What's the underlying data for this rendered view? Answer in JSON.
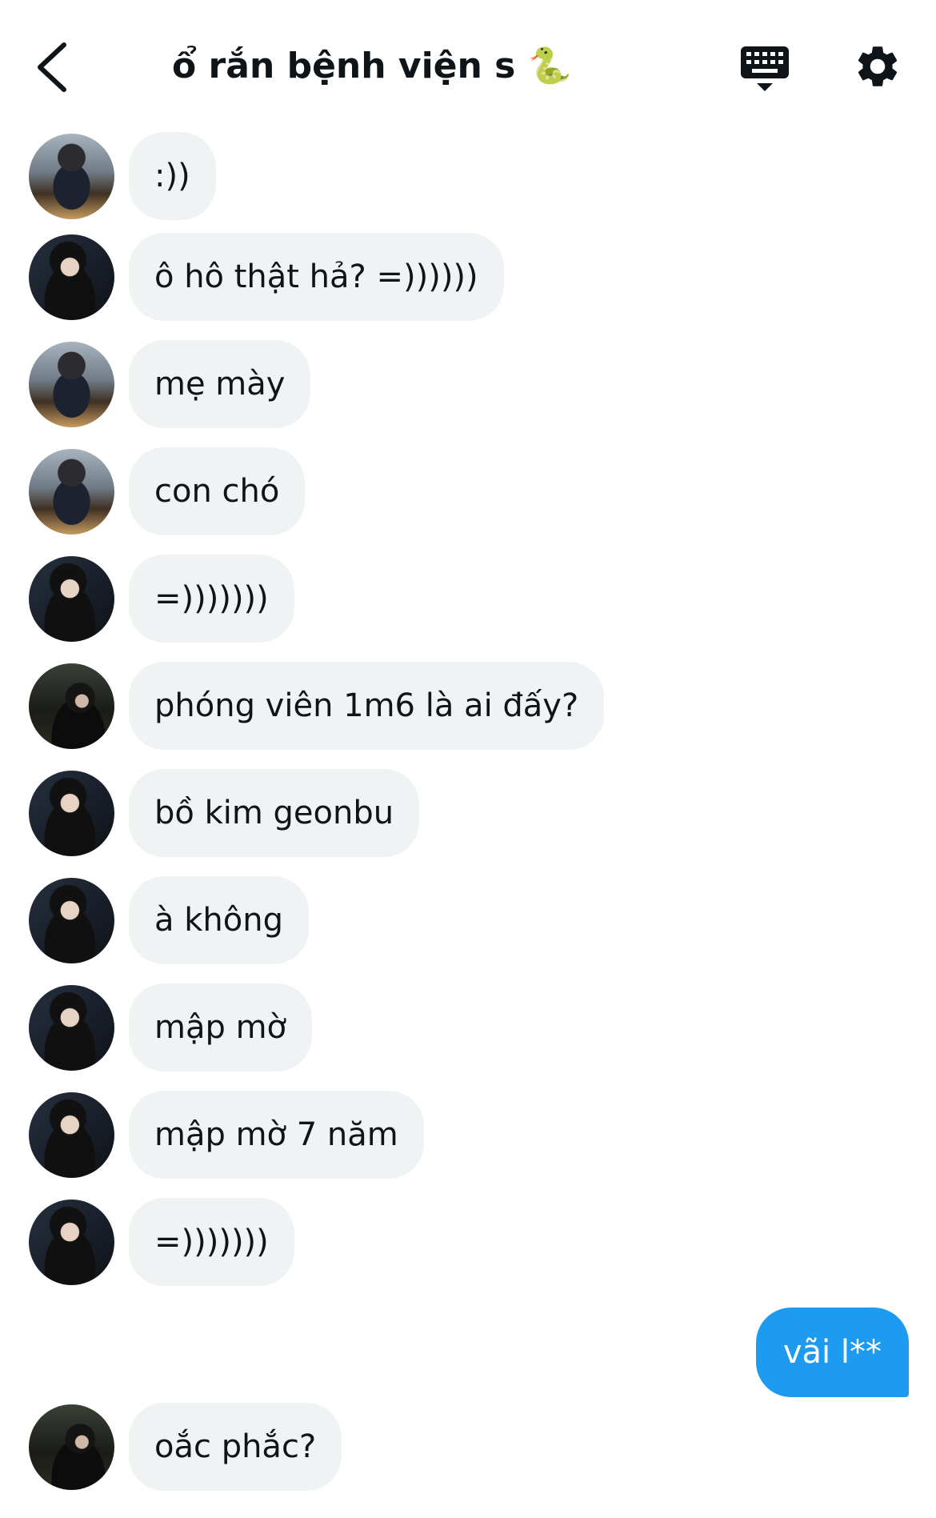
{
  "header": {
    "title": "ổ rắn bệnh viện s 🐍",
    "back_icon": "chevron-left-icon",
    "keyboard_icon": "keyboard-icon",
    "settings_icon": "gear-icon"
  },
  "colors": {
    "bubble_other": "#eff3f4",
    "bubble_mine": "#1d9bf0",
    "text": "#0f1419"
  },
  "messages": [
    {
      "sender": "friend-a",
      "text": ":))"
    },
    {
      "sender": "friend-b",
      "text": "ô hô thật hả? =))))))"
    },
    {
      "sender": "friend-a",
      "text": "mẹ mày"
    },
    {
      "sender": "friend-a",
      "text": "con chó"
    },
    {
      "sender": "friend-b",
      "text": "=)))))))"
    },
    {
      "sender": "friend-c",
      "text": "phóng viên 1m6 là ai đấy?"
    },
    {
      "sender": "friend-b",
      "text": "bồ kim geonbu"
    },
    {
      "sender": "friend-b",
      "text": "à không"
    },
    {
      "sender": "friend-b",
      "text": "mập mờ"
    },
    {
      "sender": "friend-b",
      "text": "mập mờ 7 năm"
    },
    {
      "sender": "friend-b",
      "text": "=)))))))"
    },
    {
      "sender": "me",
      "text": "vãi l**"
    },
    {
      "sender": "friend-c",
      "text": "oắc phắc?"
    }
  ]
}
